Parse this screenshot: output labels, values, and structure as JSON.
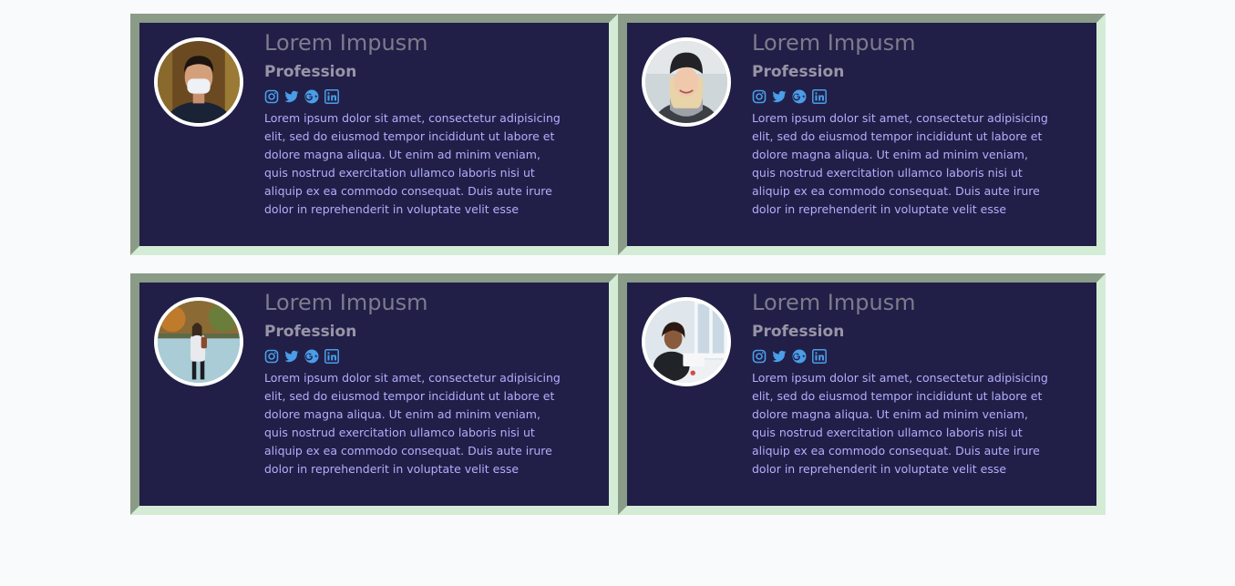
{
  "colors": {
    "card_background": "#211f47",
    "name_text": "#7d7b8d",
    "profession_text": "#9795a6",
    "bio_text": "#b3aefc",
    "icon_color": "#4a9de8"
  },
  "cards": [
    {
      "name": "Lorem Impusm",
      "profession": "Profession",
      "photo": "man-with-face-mask-photo",
      "social_icons": [
        "instagram-icon",
        "twitter-icon",
        "google-plus-icon",
        "linkedin-icon"
      ],
      "bio": "Lorem ipsum dolor sit amet, consectetur adipisicing elit, sed do eiusmod tempor incididunt ut labore et dolore magna aliqua. Ut enim ad minim veniam, quis nostrud exercitation ullamco laboris nisi ut aliquip ex ea commodo consequat. Duis aute irure dolor in reprehenderit in voluptate velit esse"
    },
    {
      "name": "Lorem Impusm",
      "profession": "Profession",
      "photo": "woman-in-beanie-photo",
      "social_icons": [
        "instagram-icon",
        "twitter-icon",
        "google-plus-icon",
        "linkedin-icon"
      ],
      "bio": "Lorem ipsum dolor sit amet, consectetur adipisicing elit, sed do eiusmod tempor incididunt ut labore et dolore magna aliqua. Ut enim ad minim veniam, quis nostrud exercitation ullamco laboris nisi ut aliquip ex ea commodo consequat. Duis aute irure dolor in reprehenderit in voluptate velit esse"
    },
    {
      "name": "Lorem Impusm",
      "profession": "Profession",
      "photo": "woman-walking-in-park-photo",
      "social_icons": [
        "instagram-icon",
        "twitter-icon",
        "google-plus-icon",
        "linkedin-icon"
      ],
      "bio": "Lorem ipsum dolor sit amet, consectetur adipisicing elit, sed do eiusmod tempor incididunt ut labore et dolore magna aliqua. Ut enim ad minim veniam, quis nostrud exercitation ullamco laboris nisi ut aliquip ex ea commodo consequat. Duis aute irure dolor in reprehenderit in voluptate velit esse"
    },
    {
      "name": "Lorem Impusm",
      "profession": "Profession",
      "photo": "woman-at-laptop-photo",
      "social_icons": [
        "instagram-icon",
        "twitter-icon",
        "google-plus-icon",
        "linkedin-icon"
      ],
      "bio": "Lorem ipsum dolor sit amet, consectetur adipisicing elit, sed do eiusmod tempor incididunt ut labore et dolore magna aliqua. Ut enim ad minim veniam, quis nostrud exercitation ullamco laboris nisi ut aliquip ex ea commodo consequat. Duis aute irure dolor in reprehenderit in voluptate velit esse"
    }
  ]
}
